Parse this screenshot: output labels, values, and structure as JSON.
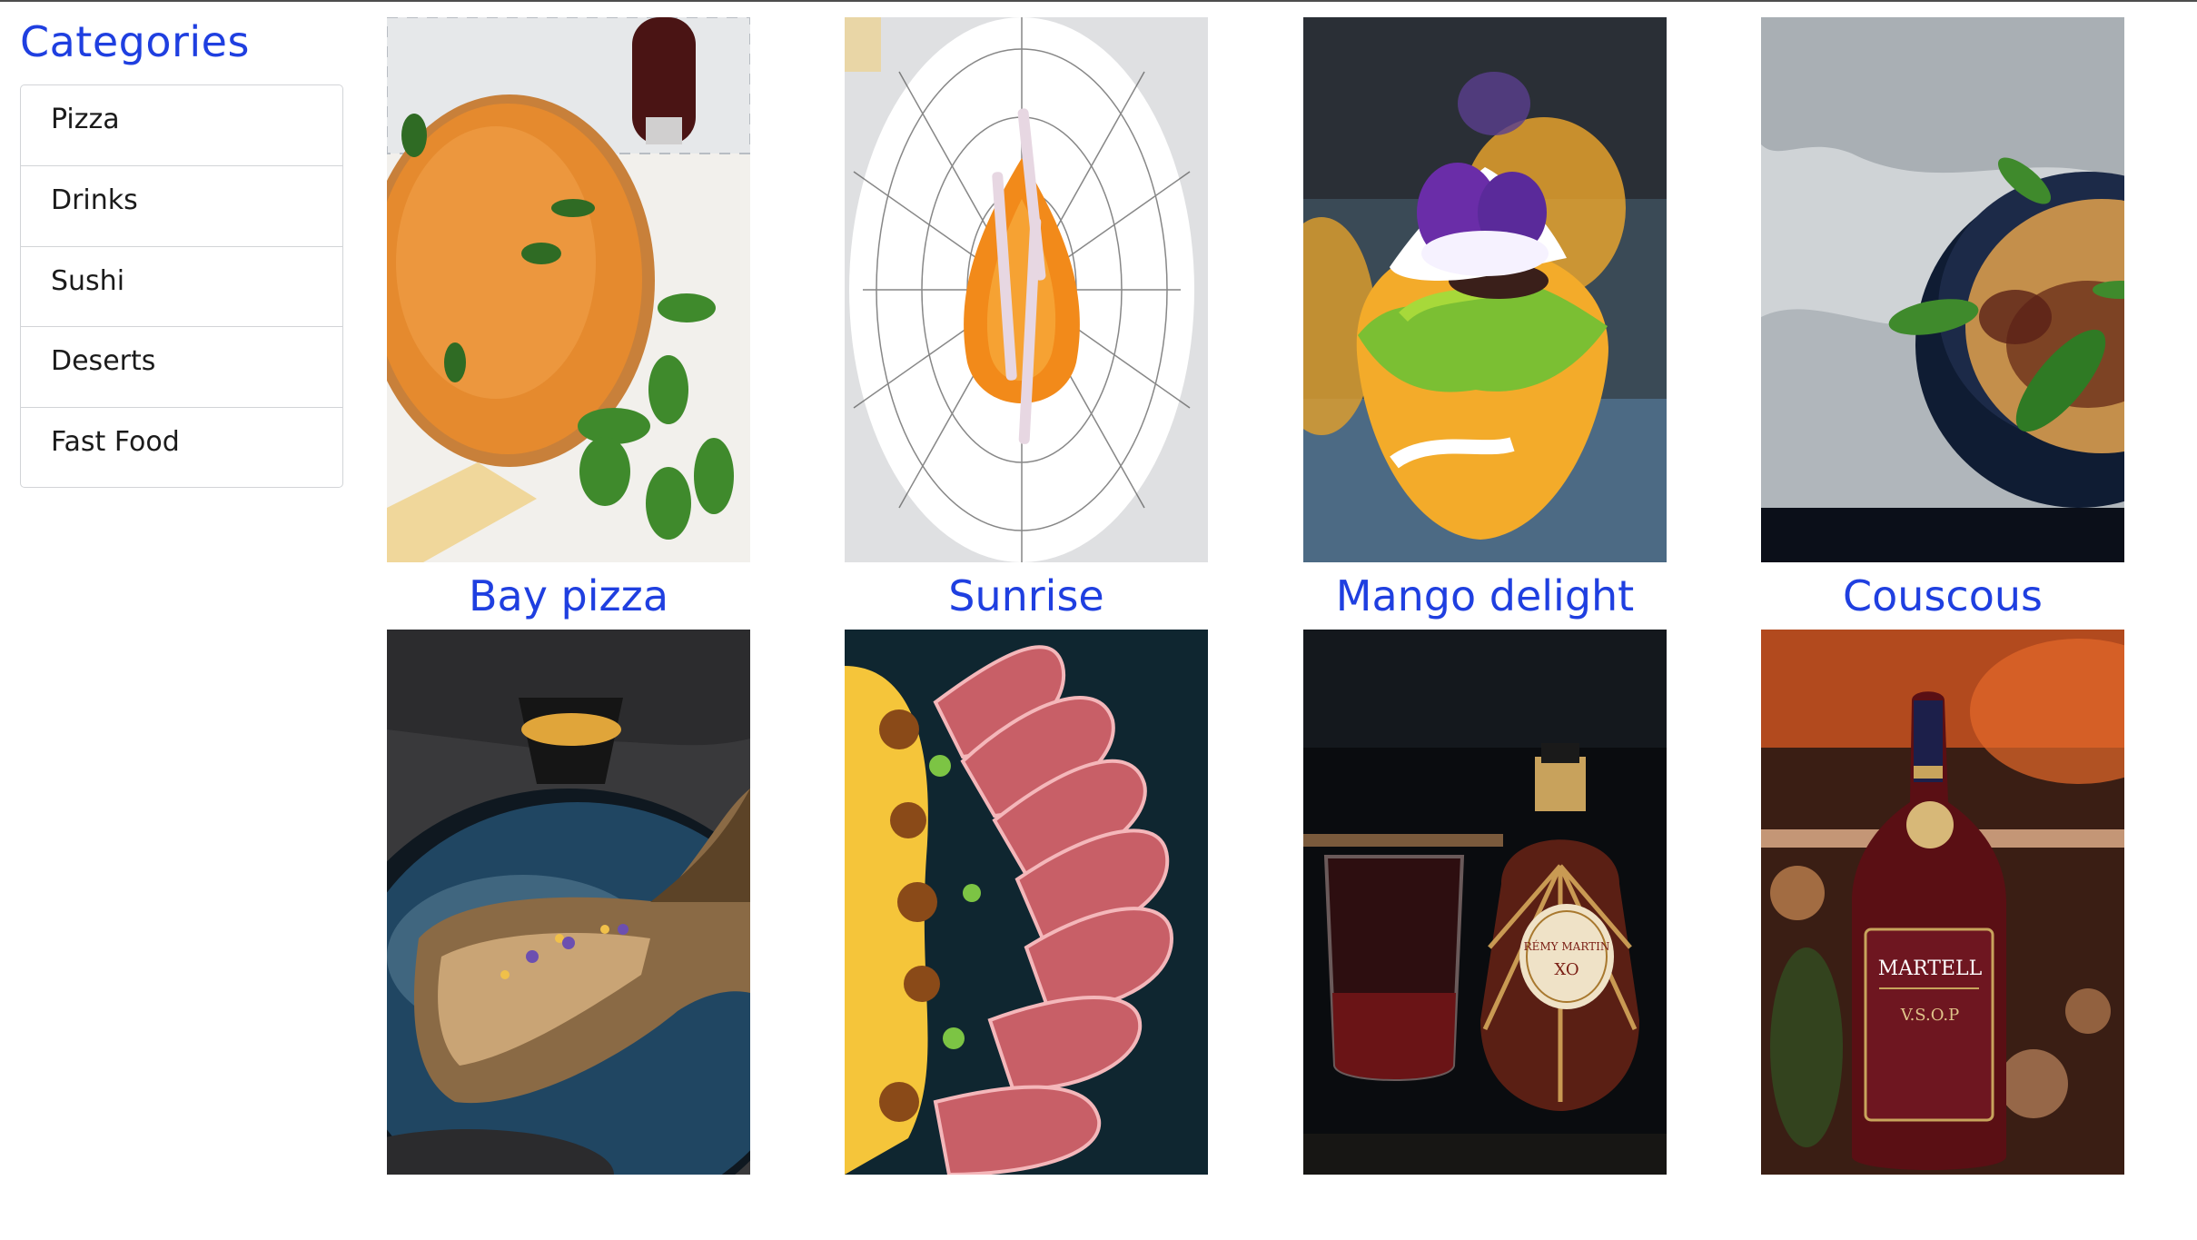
{
  "sidebar": {
    "title": "Categories",
    "items": [
      {
        "label": "Pizza"
      },
      {
        "label": "Drinks"
      },
      {
        "label": "Sushi"
      },
      {
        "label": "Deserts"
      },
      {
        "label": "Fast Food"
      }
    ]
  },
  "products": [
    {
      "title": "Bay pizza",
      "image": "pizza-photo"
    },
    {
      "title": "Sunrise",
      "image": "plated-dessert-photo"
    },
    {
      "title": "Mango delight",
      "image": "mango-dessert-photo"
    },
    {
      "title": "Couscous",
      "image": "couscous-bowl-photo"
    },
    {
      "title": "",
      "image": "grilled-fish-photo"
    },
    {
      "title": "",
      "image": "seared-tuna-photo"
    },
    {
      "title": "",
      "image": "remy-martin-cognac-photo"
    },
    {
      "title": "",
      "image": "martell-cognac-photo"
    }
  ],
  "labels": {
    "remy": "RÉMY MARTIN",
    "remy_grade": "XO",
    "martell": "MARTELL",
    "martell_grade": "V.S.O.P"
  },
  "colors": {
    "accent": "#1f3fe0",
    "text": "#1b1b1b",
    "border": "#d2d4d7"
  }
}
